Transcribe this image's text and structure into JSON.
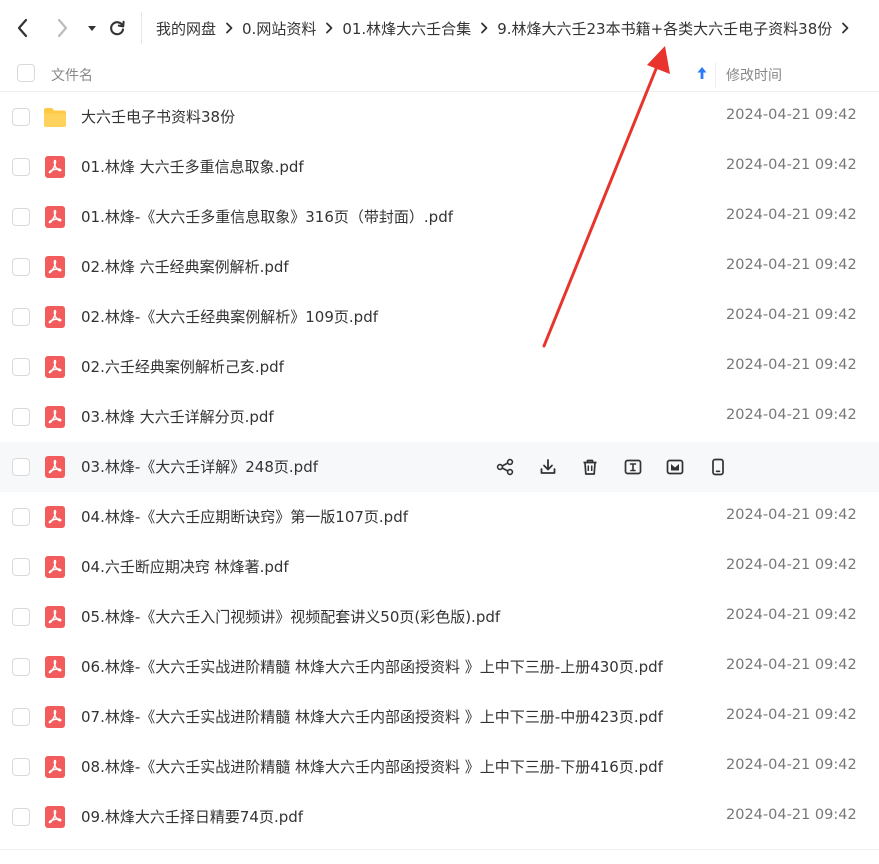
{
  "nav": {
    "back_icon": "chevron-left-icon",
    "forward_icon": "chevron-right-icon",
    "dropdown_icon": "caret-down-icon",
    "refresh_icon": "refresh-icon"
  },
  "breadcrumb": [
    "我的网盘",
    "0.网站资料",
    "01.林烽大六壬合集",
    "9.林烽大六壬23本书籍+各类大六壬电子资料38份"
  ],
  "header": {
    "name_label": "文件名",
    "time_label": "修改时间",
    "sort_icon": "arrow-up-icon"
  },
  "colors": {
    "accent": "#2b7bff",
    "pdf_red": "#f25c5c",
    "folder_yellow": "#ffc845",
    "annotation_red": "#e8342c"
  },
  "files": [
    {
      "name": "大六壬电子书资料38份",
      "time": "2024-04-21 09:42",
      "type": "folder"
    },
    {
      "name": "01.林烽 大六壬多重信息取象.pdf",
      "time": "2024-04-21 09:42",
      "type": "pdf"
    },
    {
      "name": "01.林烽-《大六壬多重信息取象》316页（带封面）.pdf",
      "time": "2024-04-21 09:42",
      "type": "pdf"
    },
    {
      "name": "02.林烽 六壬经典案例解析.pdf",
      "time": "2024-04-21 09:42",
      "type": "pdf"
    },
    {
      "name": "02.林烽-《大六壬经典案例解析》109页.pdf",
      "time": "2024-04-21 09:42",
      "type": "pdf"
    },
    {
      "name": "02.六壬经典案例解析己亥.pdf",
      "time": "2024-04-21 09:42",
      "type": "pdf"
    },
    {
      "name": "03.林烽 大六壬详解分页.pdf",
      "time": "2024-04-21 09:42",
      "type": "pdf"
    },
    {
      "name": "03.林烽-《大六壬详解》248页.pdf",
      "time": "",
      "type": "pdf",
      "hovered": true
    },
    {
      "name": "04.林烽-《大六壬应期断诀窍》第一版107页.pdf",
      "time": "2024-04-21 09:42",
      "type": "pdf"
    },
    {
      "name": "04.六壬断应期决窍 林烽著.pdf",
      "time": "2024-04-21 09:42",
      "type": "pdf"
    },
    {
      "name": "05.林烽-《大六壬入门视频讲》视频配套讲义50页(彩色版).pdf",
      "time": "2024-04-21 09:42",
      "type": "pdf"
    },
    {
      "name": "06.林烽-《大六壬实战进阶精髓 林烽大六壬内部函授资料 》上中下三册-上册430页.pdf",
      "time": "2024-04-21 09:42",
      "type": "pdf"
    },
    {
      "name": "07.林烽-《大六壬实战进阶精髓 林烽大六壬内部函授资料 》上中下三册-中册423页.pdf",
      "time": "2024-04-21 09:42",
      "type": "pdf"
    },
    {
      "name": "08.林烽-《大六壬实战进阶精髓 林烽大六壬内部函授资料 》上中下三册-下册416页.pdf",
      "time": "2024-04-21 09:42",
      "type": "pdf"
    },
    {
      "name": "09.林烽大六壬择日精要74页.pdf",
      "time": "2024-04-21 09:42",
      "type": "pdf"
    }
  ],
  "row_actions": [
    "share-icon",
    "download-icon",
    "delete-icon",
    "rename-icon",
    "move-icon",
    "mobile-icon"
  ]
}
